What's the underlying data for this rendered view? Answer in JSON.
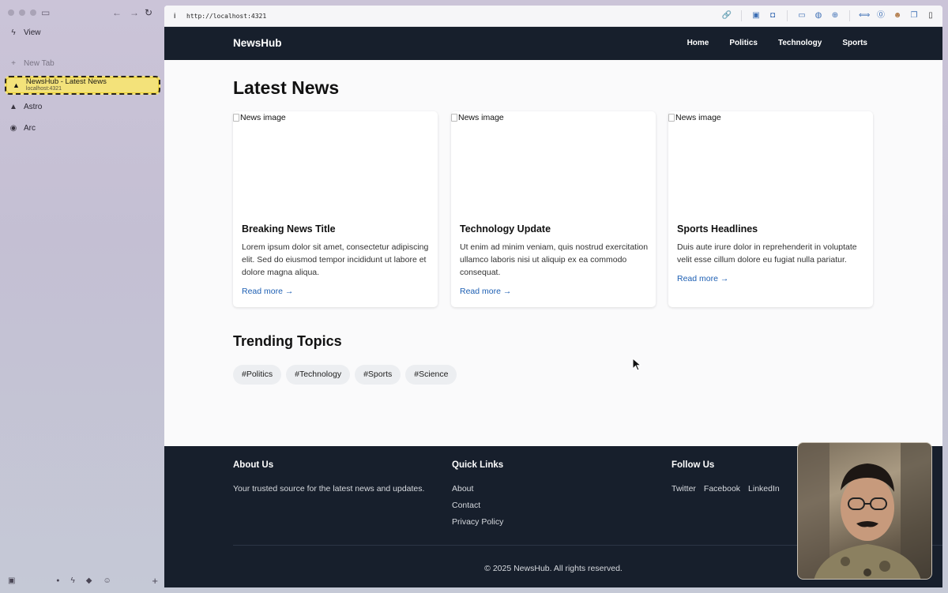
{
  "sidebar": {
    "view_label": "View",
    "new_tab_label": "New Tab",
    "active_tab": {
      "title": "NewsHub - Latest News",
      "subtitle": "localhost:4321"
    },
    "tabs": [
      {
        "label": "Astro",
        "icon": "astro-icon"
      },
      {
        "label": "Arc",
        "icon": "arc-icon"
      }
    ]
  },
  "browser": {
    "url": "http://localhost:4321"
  },
  "site": {
    "brand": "NewsHub",
    "nav": [
      "Home",
      "Politics",
      "Technology",
      "Sports"
    ],
    "latest_heading": "Latest News",
    "image_alt": "News image",
    "cards": [
      {
        "title": "Breaking News Title",
        "body": "Lorem ipsum dolor sit amet, consectetur adipiscing elit. Sed do eiusmod tempor incididunt ut labore et dolore magna aliqua.",
        "link": "Read more →"
      },
      {
        "title": "Technology Update",
        "body": "Ut enim ad minim veniam, quis nostrud exercitation ullamco laboris nisi ut aliquip ex ea commodo consequat.",
        "link": "Read more →"
      },
      {
        "title": "Sports Headlines",
        "body": "Duis aute irure dolor in reprehenderit in voluptate velit esse cillum dolore eu fugiat nulla pariatur.",
        "link": "Read more →"
      }
    ],
    "trending_heading": "Trending Topics",
    "tags": [
      "#Politics",
      "#Technology",
      "#Sports",
      "#Science"
    ],
    "footer": {
      "about_heading": "About Us",
      "about_text": "Your trusted source for the latest news and updates.",
      "links_heading": "Quick Links",
      "links": [
        "About",
        "Contact",
        "Privacy Policy"
      ],
      "follow_heading": "Follow Us",
      "social": [
        "Twitter",
        "Facebook",
        "LinkedIn"
      ],
      "copyright": "© 2025 NewsHub. All rights reserved."
    }
  }
}
